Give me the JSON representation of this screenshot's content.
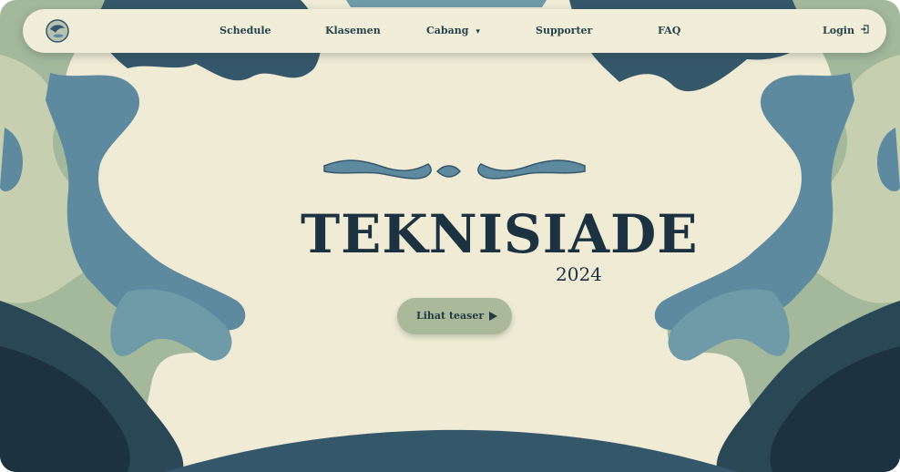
{
  "nav": {
    "items": [
      {
        "label": "Schedule"
      },
      {
        "label": "Klasemen"
      },
      {
        "label": "Cabang"
      },
      {
        "label": "Supporter"
      },
      {
        "label": "FAQ"
      }
    ],
    "login_label": "Login",
    "icons": {
      "logo": "logo-icon",
      "dropdown": "chevron-down-icon",
      "login": "login-icon"
    }
  },
  "hero": {
    "title": "TEKNISIADE",
    "year": "2024",
    "button_label": "Lihat teaser",
    "button_icon": "play-icon"
  },
  "colors": {
    "background": "#efebd5",
    "dark_teal": "#1c3240",
    "mid_teal": "#35576a",
    "blue_teal": "#5e8aa0",
    "sage": "#a9b99a"
  }
}
